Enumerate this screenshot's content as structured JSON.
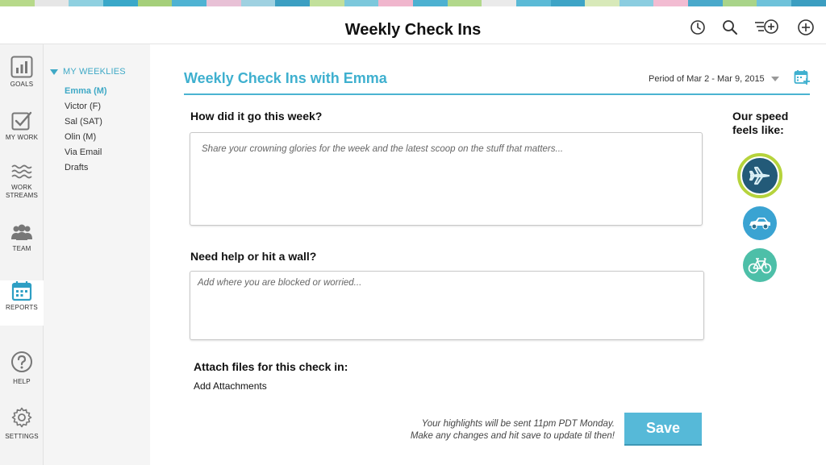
{
  "stripe_colors": [
    "#b7d98a",
    "#e6e6e6",
    "#8fd0e0",
    "#3aa8c9",
    "#a5cf7a",
    "#4fb3d3",
    "#e8c1d6",
    "#9fd1e1",
    "#3c9fc2",
    "#c2e09b",
    "#7cc8dc",
    "#f0b6cd",
    "#4db1d1",
    "#b2d88b",
    "#eaeaea",
    "#5bbad6",
    "#3ea4c6",
    "#d8e9b9",
    "#8bcde0",
    "#f2bcd2",
    "#4aa9cb",
    "#a9d489",
    "#6ec2da",
    "#3c9ec1"
  ],
  "header": {
    "title": "Weekly Check Ins",
    "icons": [
      "clock-icon",
      "search-icon",
      "add-list-icon",
      "add-icon"
    ]
  },
  "nav": {
    "items": [
      {
        "label": "GOALS",
        "icon": "goals-chart-icon"
      },
      {
        "label": "MY WORK",
        "icon": "checkbox-icon"
      },
      {
        "label": "WORK\nSTREAMS",
        "icon": "waves-icon"
      },
      {
        "label": "TEAM",
        "icon": "team-icon"
      },
      {
        "label": "REPORTS",
        "icon": "calendar-icon",
        "active": true
      },
      {
        "label": "HELP",
        "icon": "help-icon"
      },
      {
        "label": "SETTINGS",
        "icon": "gear-icon"
      }
    ]
  },
  "subnav": {
    "heading": "MY WEEKLIES",
    "items": [
      {
        "label": "Emma (M)",
        "active": true
      },
      {
        "label": "Victor (F)"
      },
      {
        "label": "Sal (SAT)"
      },
      {
        "label": "Olin (M)"
      },
      {
        "label": "Via Email"
      },
      {
        "label": "Drafts"
      }
    ]
  },
  "main": {
    "title": "Weekly Check Ins with Emma",
    "period": "Period of Mar 2 - Mar 9, 2015",
    "q1": {
      "label": "How did it go this week?",
      "placeholder": "Share your crowning glories for the week and the latest scoop on the stuff that matters..."
    },
    "q2": {
      "label": "Need help or hit a wall?",
      "placeholder": "Add where you are blocked or worried..."
    },
    "attach": {
      "label": "Attach files for this check in:",
      "link": "Add Attachments"
    },
    "note_line1": "Your highlights will be sent 11pm PDT Monday.",
    "note_line2": "Make any changes and hit save to update til then!",
    "save_label": "Save"
  },
  "speed": {
    "title": "Our speed feels like:",
    "options": [
      {
        "icon": "airplane-icon",
        "selected": true,
        "color": "#235a78",
        "ring": "#b6d33c"
      },
      {
        "icon": "car-icon",
        "selected": false,
        "color": "#3aa3d2"
      },
      {
        "icon": "bicycle-icon",
        "selected": false,
        "color": "#4dbfa8"
      }
    ]
  }
}
